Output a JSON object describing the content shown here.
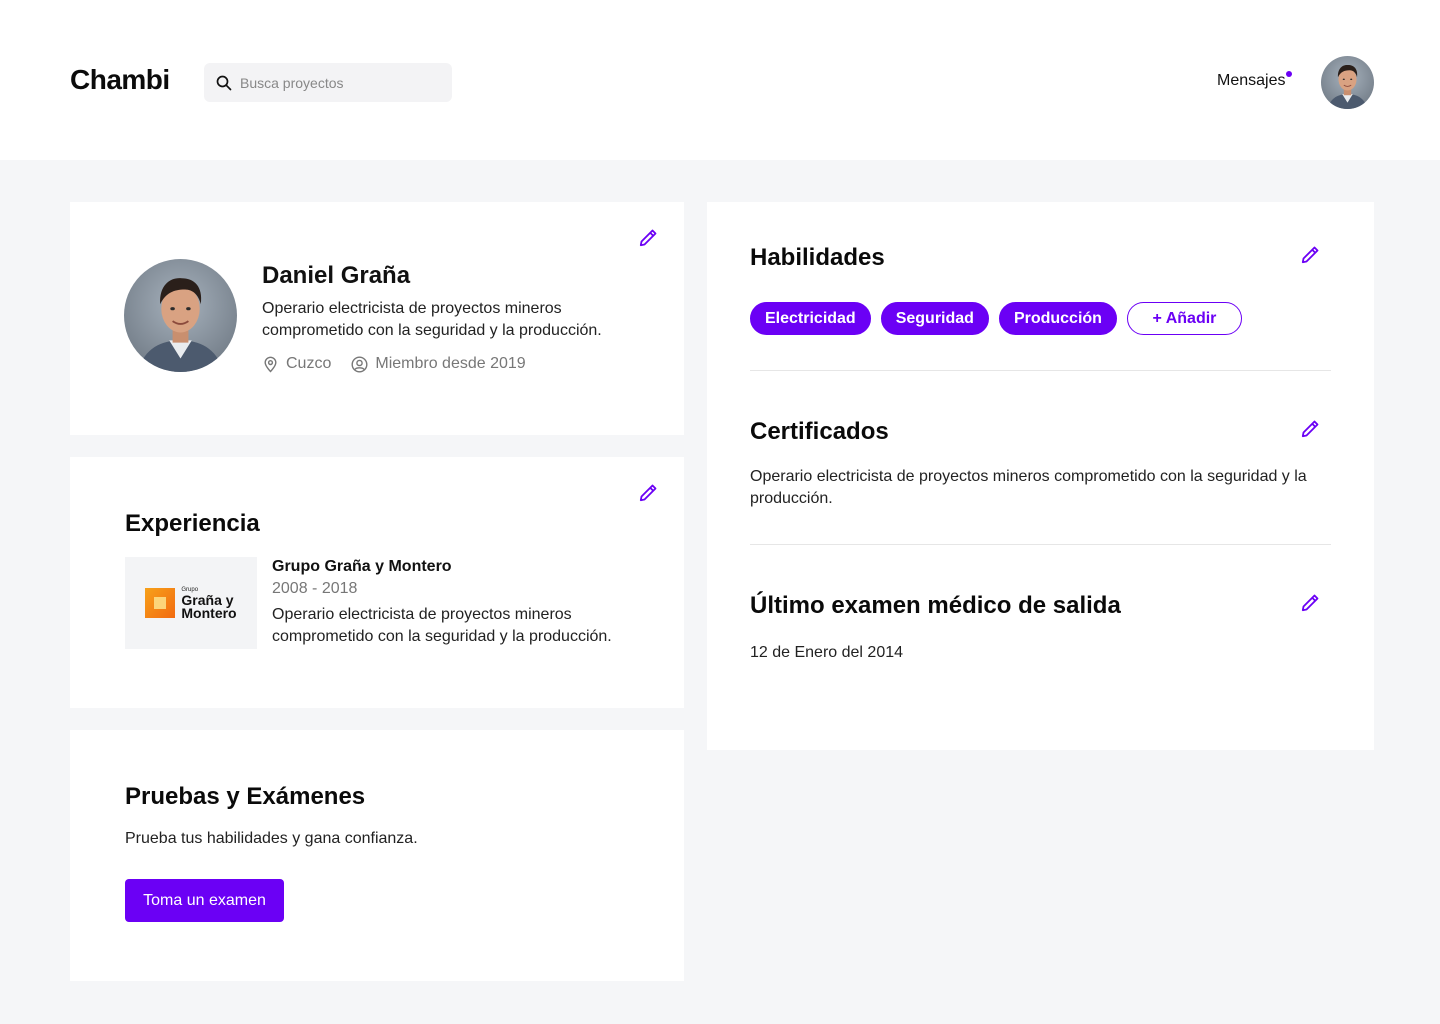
{
  "header": {
    "logo": "Chambi",
    "search_placeholder": "Busca proyectos",
    "messages_label": "Mensajes"
  },
  "profile": {
    "name": "Daniel Graña",
    "bio": "Operario electricista de proyectos mineros comprometido con la seguridad y la producción.",
    "location": "Cuzco",
    "member_since": "Miembro desde 2019"
  },
  "experience": {
    "title": "Experiencia",
    "items": [
      {
        "company": "Grupo Graña y Montero",
        "logo_small": "Grupo",
        "logo_line1": "Graña y",
        "logo_line2": "Montero",
        "years": "2008 - 2018",
        "description": "Operario electricista de proyectos mineros comprometido con la seguridad y la producción."
      }
    ]
  },
  "tests": {
    "title": "Pruebas y Exámenes",
    "subtitle": "Prueba tus habilidades y gana confianza.",
    "button_label": "Toma un examen"
  },
  "skills": {
    "title": "Habilidades",
    "items": [
      "Electricidad",
      "Seguridad",
      "Producción"
    ],
    "add_label": "+ Añadir"
  },
  "certificates": {
    "title": "Certificados",
    "text": "Operario electricista de proyectos mineros comprometido con la seguridad y la producción."
  },
  "medical_exam": {
    "title": "Último examen médico de salida",
    "date": "12 de Enero del 2014"
  },
  "colors": {
    "accent": "#6b00f5",
    "background": "#f5f6f8",
    "card": "#ffffff"
  },
  "icons": [
    "search-icon",
    "pencil-icon",
    "location-pin-icon",
    "user-circle-icon"
  ]
}
